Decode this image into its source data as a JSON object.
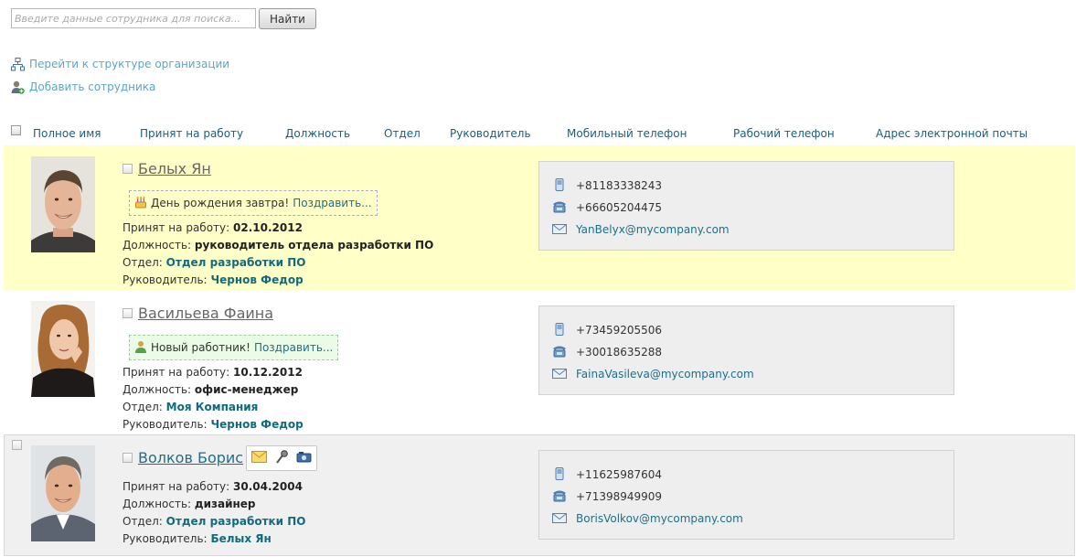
{
  "search": {
    "placeholder": "Введите данные сотрудника для поиска...",
    "button_label": "Найти"
  },
  "actions": {
    "go_structure": "Перейти к структуре организации",
    "add_employee": "Добавить сотрудника"
  },
  "columns": [
    "Полное имя",
    "Принят на работу",
    "Должность",
    "Отдел",
    "Руководитель",
    "Мобильный телефон",
    "Рабочий телефон",
    "Адрес электронной почты"
  ],
  "labels": {
    "hired": "Принят на работу:",
    "position": "Должность:",
    "department": "Отдел:",
    "manager": "Руководитель:"
  },
  "employees": [
    {
      "name": "Белых Ян",
      "event_text": "День рождения завтра!",
      "event_link": "Поздравить...",
      "event_icon": "birthday-cake-icon",
      "hired": "02.10.2012",
      "position": "руководитель отдела разработки ПО",
      "department": "Отдел разработки ПО",
      "manager": "Чернов Федор",
      "mobile": "+81183338243",
      "work_phone": "+66605204475",
      "email": "YanBelyx@mycompany.com"
    },
    {
      "name": "Васильева Фаина",
      "event_text": "Новый работник!",
      "event_link": "Поздравить...",
      "event_icon": "new-user-icon",
      "hired": "10.12.2012",
      "position": "офис-менеджер",
      "department": "Моя Компания",
      "manager": "Чернов Федор",
      "mobile": "+73459205506",
      "work_phone": "+30018635288",
      "email": "FainaVasileva@mycompany.com"
    },
    {
      "name": "Волков Борис",
      "hired": "30.04.2004",
      "position": "дизайнер",
      "department": "Отдел разработки ПО",
      "manager": "Белых Ян",
      "mobile": "+11625987604",
      "work_phone": "+71398949909",
      "email": "BorisVolkov@mycompany.com"
    }
  ],
  "colors": {
    "highlight_row": "#ffffc8",
    "hover_row": "#f0f0f0",
    "link": "#5aa7c5",
    "column_header": "#1a5f80",
    "bold_link": "#116b7c"
  }
}
